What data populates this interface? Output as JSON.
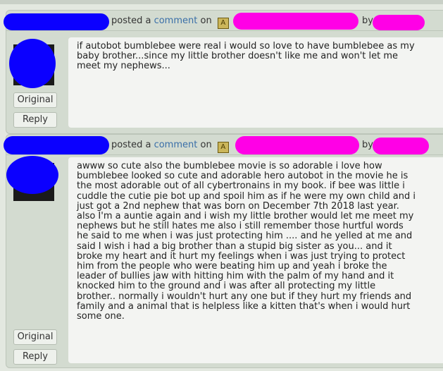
{
  "comments": [
    {
      "posted_prefix": "posted a",
      "comment_link": "comment",
      "posted_on": "on",
      "by_label": "by",
      "text": "if autobot bumblebee were real i would so love to have bumblebee as my baby brother...since my little brother doesn't like me and won't let me meet my nephews...",
      "original_label": "Original",
      "reply_label": "Reply"
    },
    {
      "posted_prefix": "posted a",
      "comment_link": "comment",
      "posted_on": "on",
      "by_label": "by",
      "text": "awww so cute also the bumblebee movie is so adorable i love how bumblebee looked so cute and adorable hero autobot in the movie he is the most adorable out of all cybertronains in my book. if bee was little i cuddle the cutie pie bot up and spoil him as if he were my own child and i just got a 2nd nephew that was born on December 7th 2018 last year. also I'm a auntie again and i wish my little brother would let me meet my nephews but he still hates me also i still remember those hurtful words he said to me when i was just protecting him .... and he yelled at me and said  I wish i had a big brother than a stupid big sister as you...  and it broke my heart and it hurt my feelings when i was just trying to protect him from the people who were beating him up and yeah i broke the leader of bullies jaw with hitting him with the palm of my hand and it knocked him to the ground and i was after all protecting my little brother.. normally i wouldn't hurt any one but if they hurt my friends and family and a animal that is helpless like a kitten  that's when i would hurt some one.",
      "original_label": "Original",
      "reply_label": "Reply"
    }
  ],
  "colors": {
    "redaction_blue": "#0b00ff",
    "redaction_pink": "#ff00e6",
    "link": "#3a6fa8",
    "panel": "#d3dbd0"
  }
}
